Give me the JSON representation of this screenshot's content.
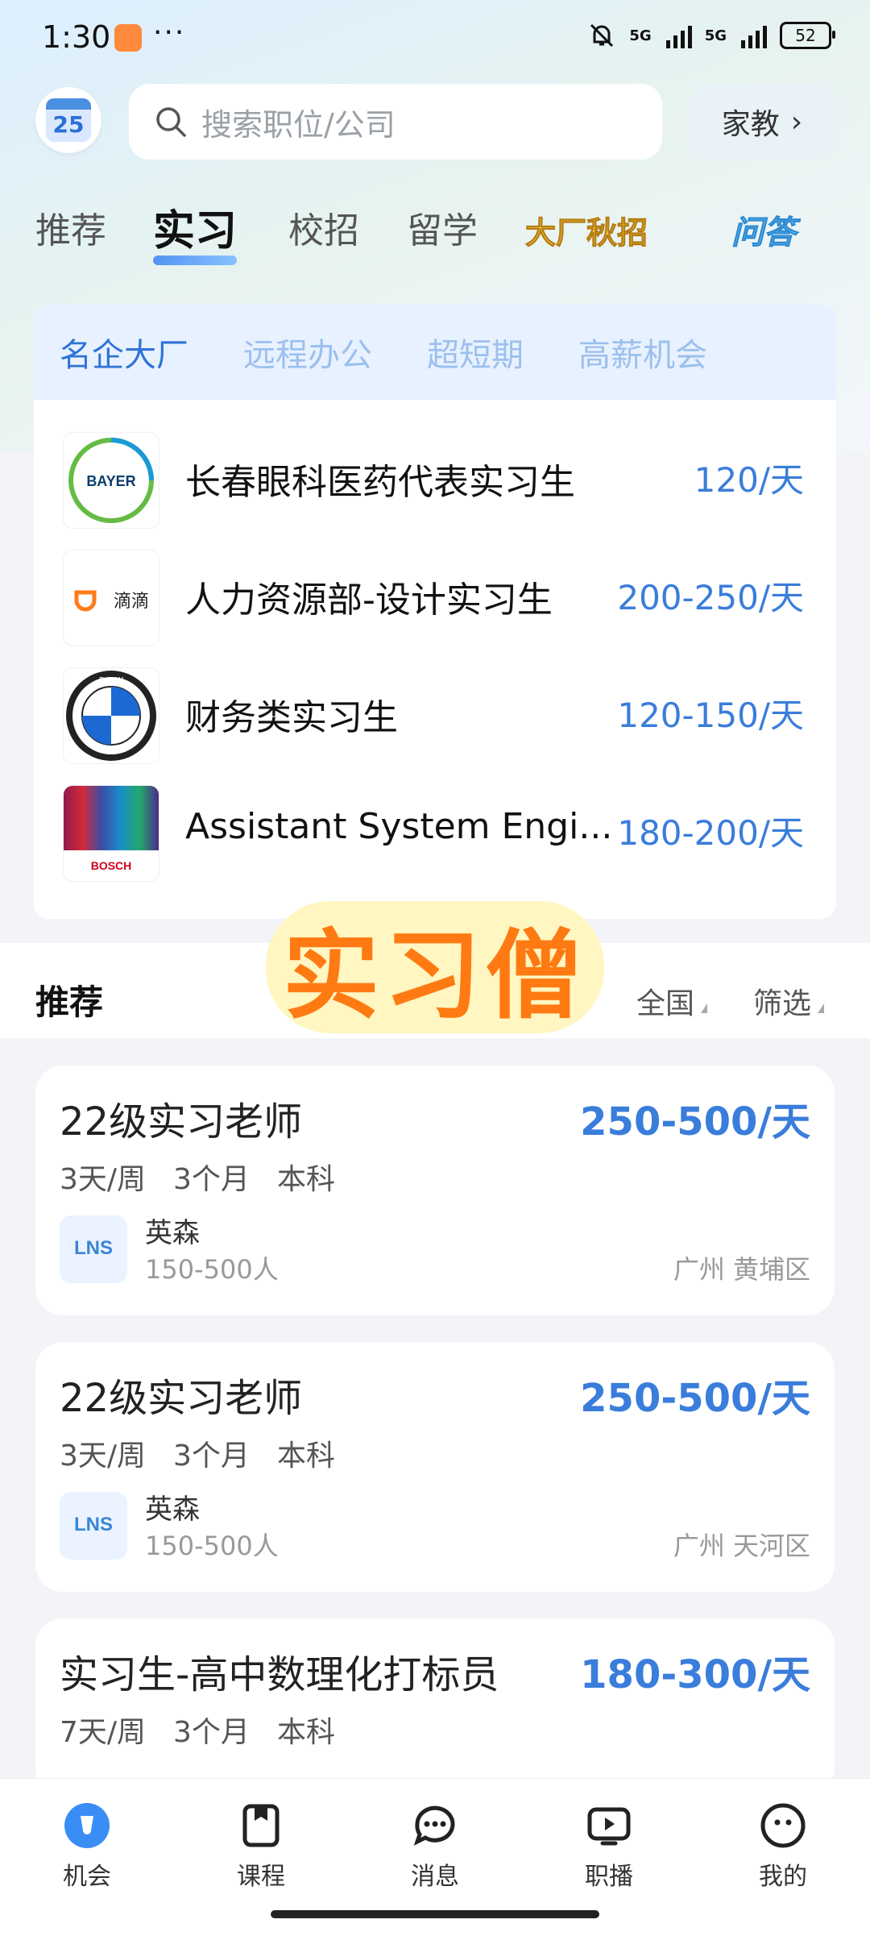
{
  "status_bar": {
    "time": "1:30",
    "more": "···",
    "net1": "5G",
    "net2": "5G",
    "battery": "52"
  },
  "header": {
    "calendar_day": "25",
    "search_placeholder": "搜索职位/公司",
    "tutor_label": "家教"
  },
  "tabs": [
    {
      "label": "推荐"
    },
    {
      "label": "实习",
      "active": true
    },
    {
      "label": "校招"
    },
    {
      "label": "留学"
    },
    {
      "label": "大厂秋招"
    },
    {
      "label": "问答"
    }
  ],
  "featured": {
    "subtabs": [
      "名企大厂",
      "远程办公",
      "超短期",
      "高薪机会"
    ],
    "rows": [
      {
        "title": "长春眼科医药代表实习生",
        "pay": "120/天",
        "logo": "bayer-logo",
        "logo_text": "BAYER"
      },
      {
        "title": "人力资源部-设计实习生",
        "pay": "200-250/天",
        "logo": "didi-logo",
        "logo_text": "滴滴"
      },
      {
        "title": "财务类实习生",
        "pay": "120-150/天",
        "logo": "bmw-logo",
        "logo_text": "B M W"
      },
      {
        "title": "Assistant System Engi...",
        "pay": "180-200/天",
        "logo": "bosch-logo",
        "logo_text": "BOSCH"
      }
    ]
  },
  "recommend": {
    "title": "推荐",
    "filter_region": "全国",
    "filter": "筛选",
    "stamp": "实习僧"
  },
  "jobs": [
    {
      "title": "22级实习老师",
      "pay": "250-500/天",
      "tags": [
        "3天/周",
        "3个月",
        "本科"
      ],
      "company": "英森",
      "size": "150-500人",
      "location": "广州 黄埔区"
    },
    {
      "title": "22级实习老师",
      "pay": "250-500/天",
      "tags": [
        "3天/周",
        "3个月",
        "本科"
      ],
      "company": "英森",
      "size": "150-500人",
      "location": "广州 天河区"
    },
    {
      "title": "实习生-高中数理化打标员",
      "pay": "180-300/天",
      "tags": [
        "7天/周",
        "3个月",
        "本科"
      ]
    }
  ],
  "nav": [
    {
      "label": "机会",
      "icon": "opportunity-icon",
      "active": true
    },
    {
      "label": "课程",
      "icon": "course-icon"
    },
    {
      "label": "消息",
      "icon": "message-icon"
    },
    {
      "label": "职播",
      "icon": "live-icon"
    },
    {
      "label": "我的",
      "icon": "profile-icon"
    }
  ],
  "colors": {
    "accent": "#3a7ddb",
    "stamp": "#ff7a12"
  }
}
